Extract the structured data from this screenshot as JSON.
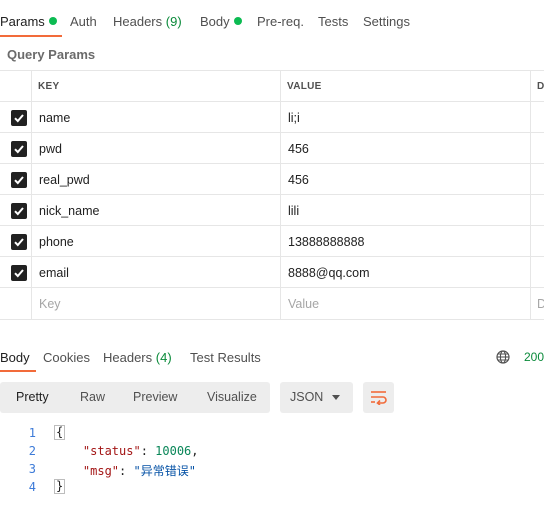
{
  "request_tabs": [
    {
      "label": "Params",
      "dot": true
    },
    {
      "label": "Auth"
    },
    {
      "label": "Headers",
      "count": "(9)"
    },
    {
      "label": "Body",
      "dot": true
    },
    {
      "label": "Pre-req."
    },
    {
      "label": "Tests"
    },
    {
      "label": "Settings"
    }
  ],
  "query_params": {
    "title": "Query Params",
    "columns": {
      "key": "KEY",
      "value": "VALUE",
      "description": "D"
    },
    "rows": [
      {
        "checked": true,
        "key": "name",
        "value": "li;i"
      },
      {
        "checked": true,
        "key": "pwd",
        "value": "456"
      },
      {
        "checked": true,
        "key": "real_pwd",
        "value": "456"
      },
      {
        "checked": true,
        "key": "nick_name",
        "value": "lili"
      },
      {
        "checked": true,
        "key": "phone",
        "value": "13888888888"
      },
      {
        "checked": true,
        "key": "email",
        "value": "8888@qq.com"
      }
    ],
    "placeholder": {
      "key": "Key",
      "value": "Value",
      "description": "D"
    }
  },
  "response_tabs": [
    {
      "label": "Body"
    },
    {
      "label": "Cookies"
    },
    {
      "label": "Headers",
      "count": "(4)"
    },
    {
      "label": "Test Results"
    }
  ],
  "status_code": "200",
  "view_modes": [
    "Pretty",
    "Raw",
    "Preview",
    "Visualize"
  ],
  "format": "JSON",
  "code": {
    "line_numbers": [
      "1",
      "2",
      "3",
      "4"
    ],
    "open_brace": "{",
    "status_key": "\"status\"",
    "status_value": "10006",
    "msg_key": "\"msg\"",
    "msg_value": "\"异常错误\"",
    "close_brace": "}"
  },
  "colors": {
    "accent": "#f26b3a",
    "success": "#0cbb52"
  }
}
